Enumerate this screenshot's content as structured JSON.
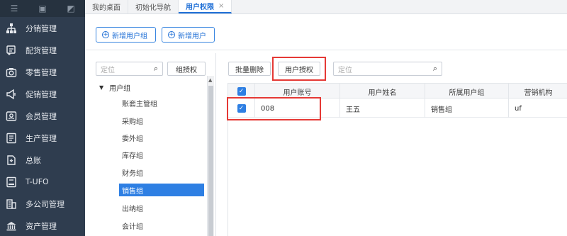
{
  "sidebar": {
    "top_icons": [
      "menu-icon",
      "screen-icon",
      "shortcut-icon"
    ],
    "items": [
      {
        "label": "分销管理",
        "icon": "org-chart-icon"
      },
      {
        "label": "配货管理",
        "icon": "delivery-icon"
      },
      {
        "label": "零售管理",
        "icon": "camera-icon"
      },
      {
        "label": "促销管理",
        "icon": "megaphone-icon"
      },
      {
        "label": "会员管理",
        "icon": "member-card-icon"
      },
      {
        "label": "生产管理",
        "icon": "production-icon"
      },
      {
        "label": "总账",
        "icon": "ledger-icon"
      },
      {
        "label": "T-UFO",
        "icon": "ufo-report-icon"
      },
      {
        "label": "多公司管理",
        "icon": "buildings-icon"
      },
      {
        "label": "资产管理",
        "icon": "bank-icon"
      }
    ]
  },
  "tabs": [
    {
      "label": "我的桌面"
    },
    {
      "label": "初始化导航"
    },
    {
      "label": "用户权限",
      "close": "×"
    }
  ],
  "toolbar": {
    "add_group": "新增用户组",
    "add_user": "新增用户"
  },
  "left": {
    "search_placeholder": "定位",
    "group_auth": "组授权",
    "root": "用户组",
    "groups": [
      "账套主管组",
      "采购组",
      "委外组",
      "库存组",
      "财务组",
      "销售组",
      "出纳组",
      "会计组"
    ],
    "selected_index": 5
  },
  "right": {
    "batch_delete": "批量删除",
    "user_auth": "用户授权",
    "search_placeholder": "定位",
    "columns": [
      "用户账号",
      "用户姓名",
      "所属用户组",
      "营销机构"
    ],
    "rows": [
      {
        "account": "008",
        "name": "王五",
        "group": "销售组",
        "org": "uf",
        "checked": true
      }
    ]
  },
  "colors": {
    "sidebar": "#2f3d4f",
    "accent": "#2e7fe3",
    "highlight_box": "#e53935"
  }
}
